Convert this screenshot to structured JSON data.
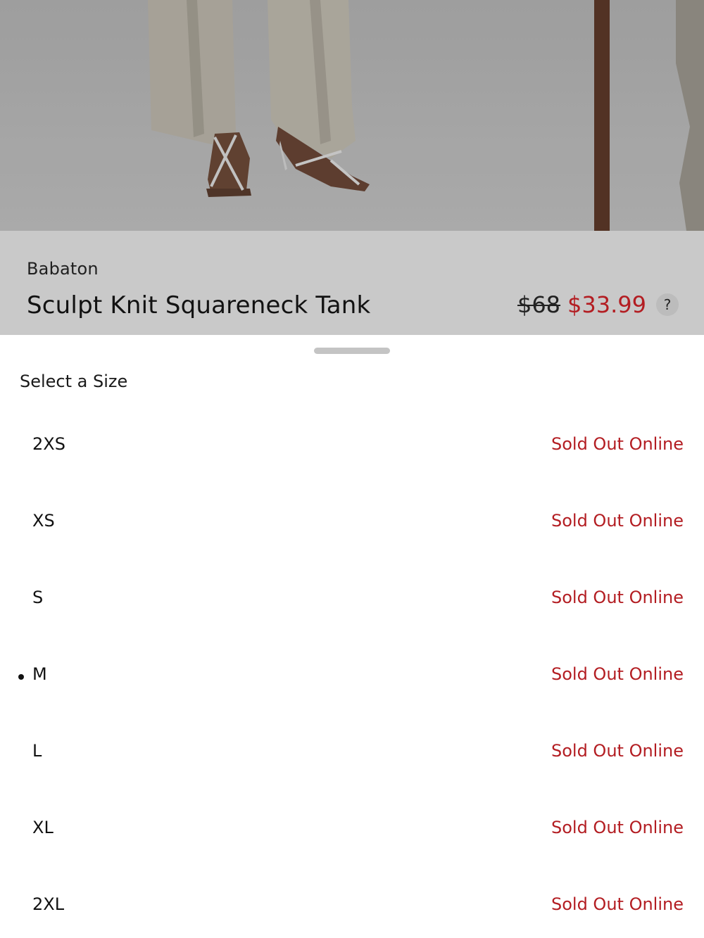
{
  "product": {
    "brand": "Babaton",
    "name": "Sculpt Knit Squareneck Tank",
    "price_original": "$68",
    "price_sale": "$33.99",
    "help_label": "?"
  },
  "colors": {
    "sale": "#b31d22",
    "sheet_bg": "#ffffff",
    "overlay_bg": "#c9c9c9"
  },
  "size_sheet": {
    "title": "Select a Size",
    "selected": "M",
    "sizes": [
      {
        "label": "2XS",
        "status": "Sold Out Online"
      },
      {
        "label": "XS",
        "status": "Sold Out Online"
      },
      {
        "label": "S",
        "status": "Sold Out Online"
      },
      {
        "label": "M",
        "status": "Sold Out Online"
      },
      {
        "label": "L",
        "status": "Sold Out Online"
      },
      {
        "label": "XL",
        "status": "Sold Out Online"
      },
      {
        "label": "2XL",
        "status": "Sold Out Online"
      }
    ]
  }
}
